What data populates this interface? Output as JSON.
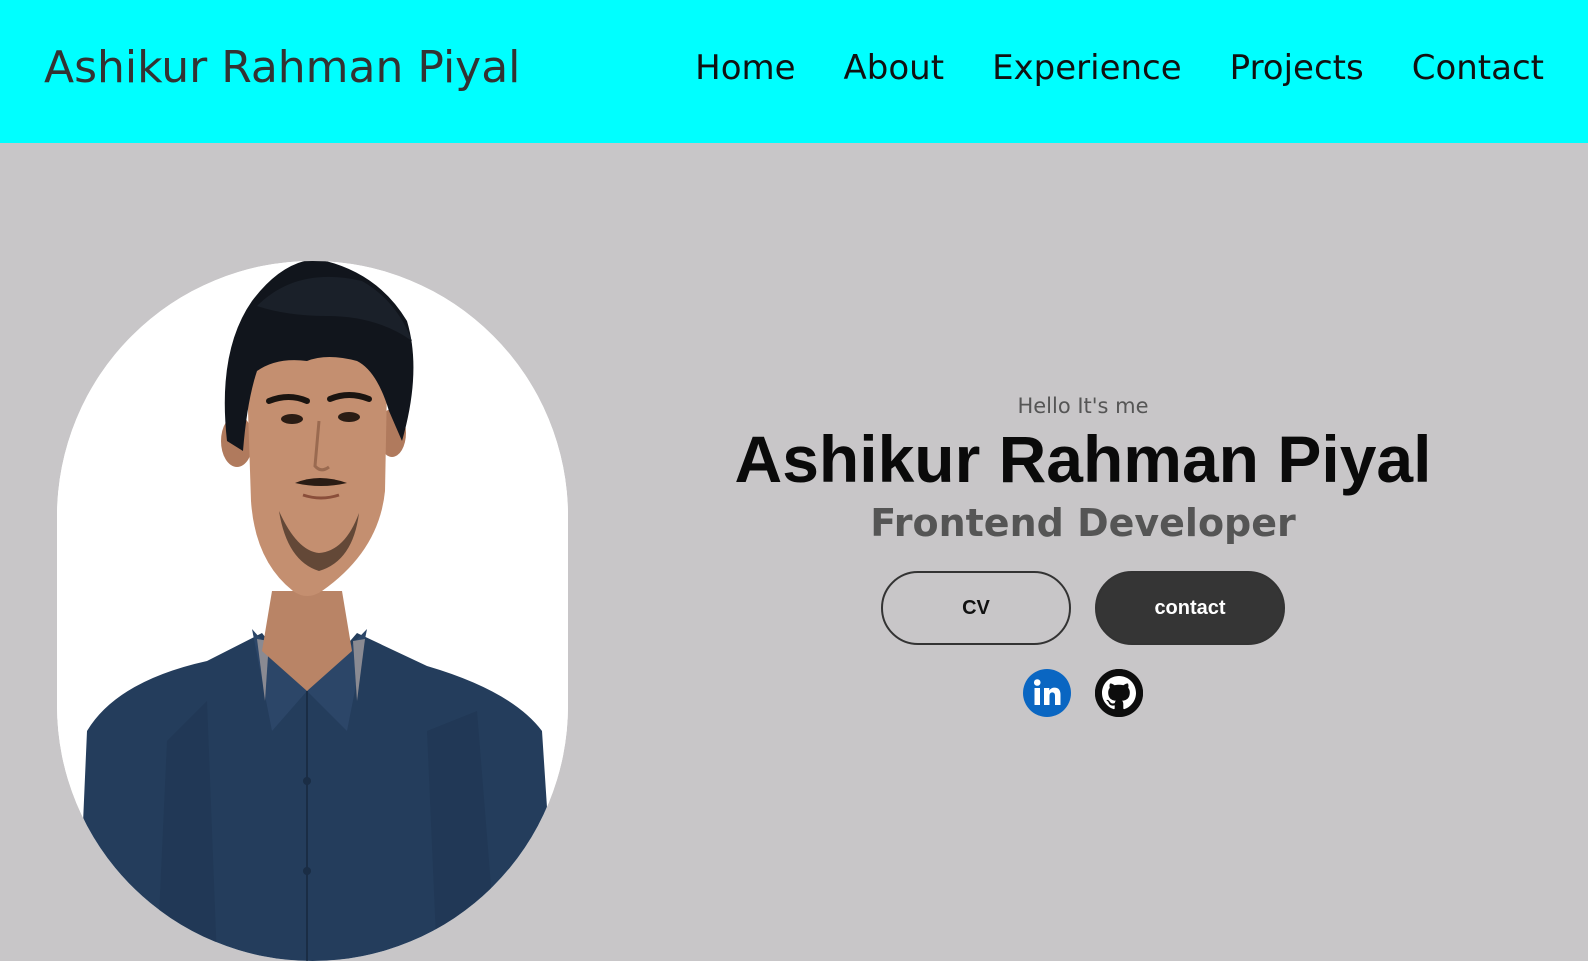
{
  "navbar": {
    "logo": "Ashikur Rahman Piyal",
    "links": [
      "Home",
      "About",
      "Experience",
      "Projects",
      "Contact"
    ],
    "background": "#00ffff"
  },
  "hero": {
    "greeting": "Hello It's me",
    "name": "Ashikur Rahman Piyal",
    "role": "Frontend Developer",
    "cv_button": "CV",
    "contact_button": "contact",
    "social": [
      "linkedin-icon",
      "github-icon"
    ],
    "background": "#c8c6c8"
  }
}
